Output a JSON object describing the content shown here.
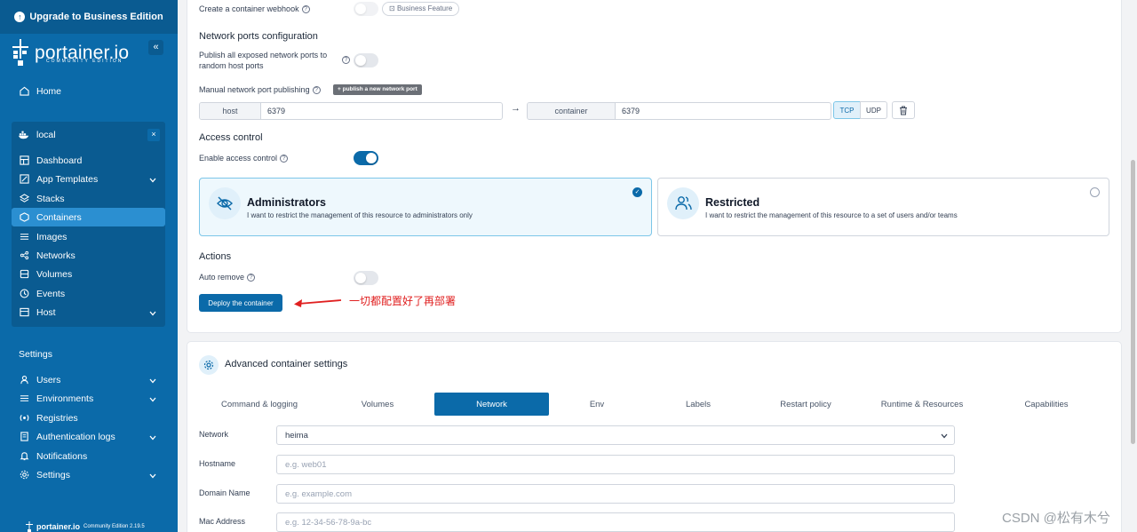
{
  "sidebar": {
    "upgrade_label": "Upgrade to Business Edition",
    "brand_name": "portainer.io",
    "brand_sub": "COMMUNITY EDITION",
    "home_label": "Home",
    "env_name": "local",
    "env_items": [
      {
        "label": "Dashboard",
        "icon": "dashboard-icon"
      },
      {
        "label": "App Templates",
        "icon": "templates-icon"
      },
      {
        "label": "Stacks",
        "icon": "stacks-icon"
      },
      {
        "label": "Containers",
        "icon": "containers-icon"
      },
      {
        "label": "Images",
        "icon": "images-icon"
      },
      {
        "label": "Networks",
        "icon": "networks-icon"
      },
      {
        "label": "Volumes",
        "icon": "volumes-icon"
      },
      {
        "label": "Events",
        "icon": "events-icon"
      },
      {
        "label": "Host",
        "icon": "host-icon"
      }
    ],
    "settings_title": "Settings",
    "settings_items": [
      {
        "label": "Users",
        "icon": "users-icon"
      },
      {
        "label": "Environments",
        "icon": "environments-icon"
      },
      {
        "label": "Registries",
        "icon": "registries-icon"
      },
      {
        "label": "Authentication logs",
        "icon": "auth-logs-icon"
      },
      {
        "label": "Notifications",
        "icon": "bell-icon"
      },
      {
        "label": "Settings",
        "icon": "gear-icon"
      }
    ],
    "footer_brand": "portainer.io",
    "footer_edition": "Community Edition  2.19.5"
  },
  "form": {
    "webhook_label": "Create a container webhook",
    "business_badge": "Business Feature",
    "ports_section": "Network ports configuration",
    "publish_all_label": "Publish all exposed network ports to random host ports",
    "manual_publish_label": "Manual network port publishing",
    "publish_new_button": "+ publish a new network port",
    "host_addon": "host",
    "host_port": "6379",
    "container_addon": "container",
    "container_port": "6379",
    "tcp_label": "TCP",
    "udp_label": "UDP",
    "access_section": "Access control",
    "enable_access_label": "Enable access control",
    "admins_title": "Administrators",
    "admins_desc": "I want to restrict the management of this resource to administrators only",
    "restricted_title": "Restricted",
    "restricted_desc": "I want to restrict the management of this resource to a set of users and/or teams",
    "actions_section": "Actions",
    "auto_remove_label": "Auto remove",
    "deploy_button": "Deploy the container",
    "annotation": "一切都配置好了再部署"
  },
  "advanced": {
    "title": "Advanced container settings",
    "tabs": [
      "Command & logging",
      "Volumes",
      "Network",
      "Env",
      "Labels",
      "Restart policy",
      "Runtime & Resources",
      "Capabilities"
    ],
    "active_tab": "Network",
    "network_label": "Network",
    "network_value": "heima",
    "hostname_label": "Hostname",
    "hostname_placeholder": "e.g. web01",
    "domain_label": "Domain Name",
    "domain_placeholder": "e.g. example.com",
    "mac_label": "Mac Address",
    "mac_placeholder": "e.g. 12-34-56-78-9a-bc"
  },
  "watermark": "CSDN @松有木兮",
  "colors": {
    "sidebar": "#0b6aa9",
    "accent": "#0b6aa9",
    "annotation": "#e02020"
  }
}
